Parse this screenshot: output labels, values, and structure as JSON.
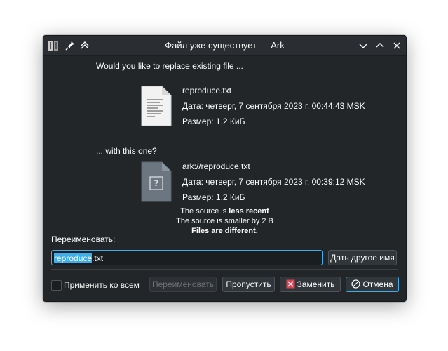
{
  "window": {
    "title": "Файл уже существует — Ark"
  },
  "dialog": {
    "question": "Would you like to replace existing file ...",
    "existing_file": {
      "name": "reproduce.txt",
      "date": "Дата: четверг, 7 сентября 2023 г. 00:44:43 MSK",
      "size": "Размер: 1,2 КиБ"
    },
    "with_this_label": "... with this one?",
    "new_file": {
      "name": "ark://reproduce.txt",
      "date": "Дата: четверг, 7 сентября 2023 г. 00:39:12 MSK",
      "size": "Размер: 1,2 КиБ"
    },
    "summary": {
      "source_prefix": "The source is ",
      "source_age": "less recent",
      "size_diff": "The source is smaller by 2 B",
      "files_different": "Files are different."
    },
    "rename_label": "Переименовать:",
    "rename_value_selected": "reproduce",
    "rename_value_rest": ".txt",
    "suggest_button": "Дать другое имя",
    "apply_all_label": "Применить ко всем",
    "buttons": {
      "rename": "Переименовать",
      "skip": "Пропустить",
      "replace": "Заменить",
      "cancel": "Отмена"
    }
  },
  "icons": {
    "app": "ark-icon",
    "pin": "pin-icon",
    "keep_above": "keep-above-icon",
    "minimize": "chevron-down-icon",
    "maximize": "chevron-up-icon",
    "close": "close-icon",
    "existing_file": "text-file-icon",
    "new_file": "unknown-file-icon",
    "replace": "replace-icon",
    "cancel": "cancel-icon"
  },
  "colors": {
    "accent": "#3daee9",
    "window_bg": "#232629",
    "titlebar_bg": "#2a2e32",
    "text": "#fcfcfc"
  }
}
